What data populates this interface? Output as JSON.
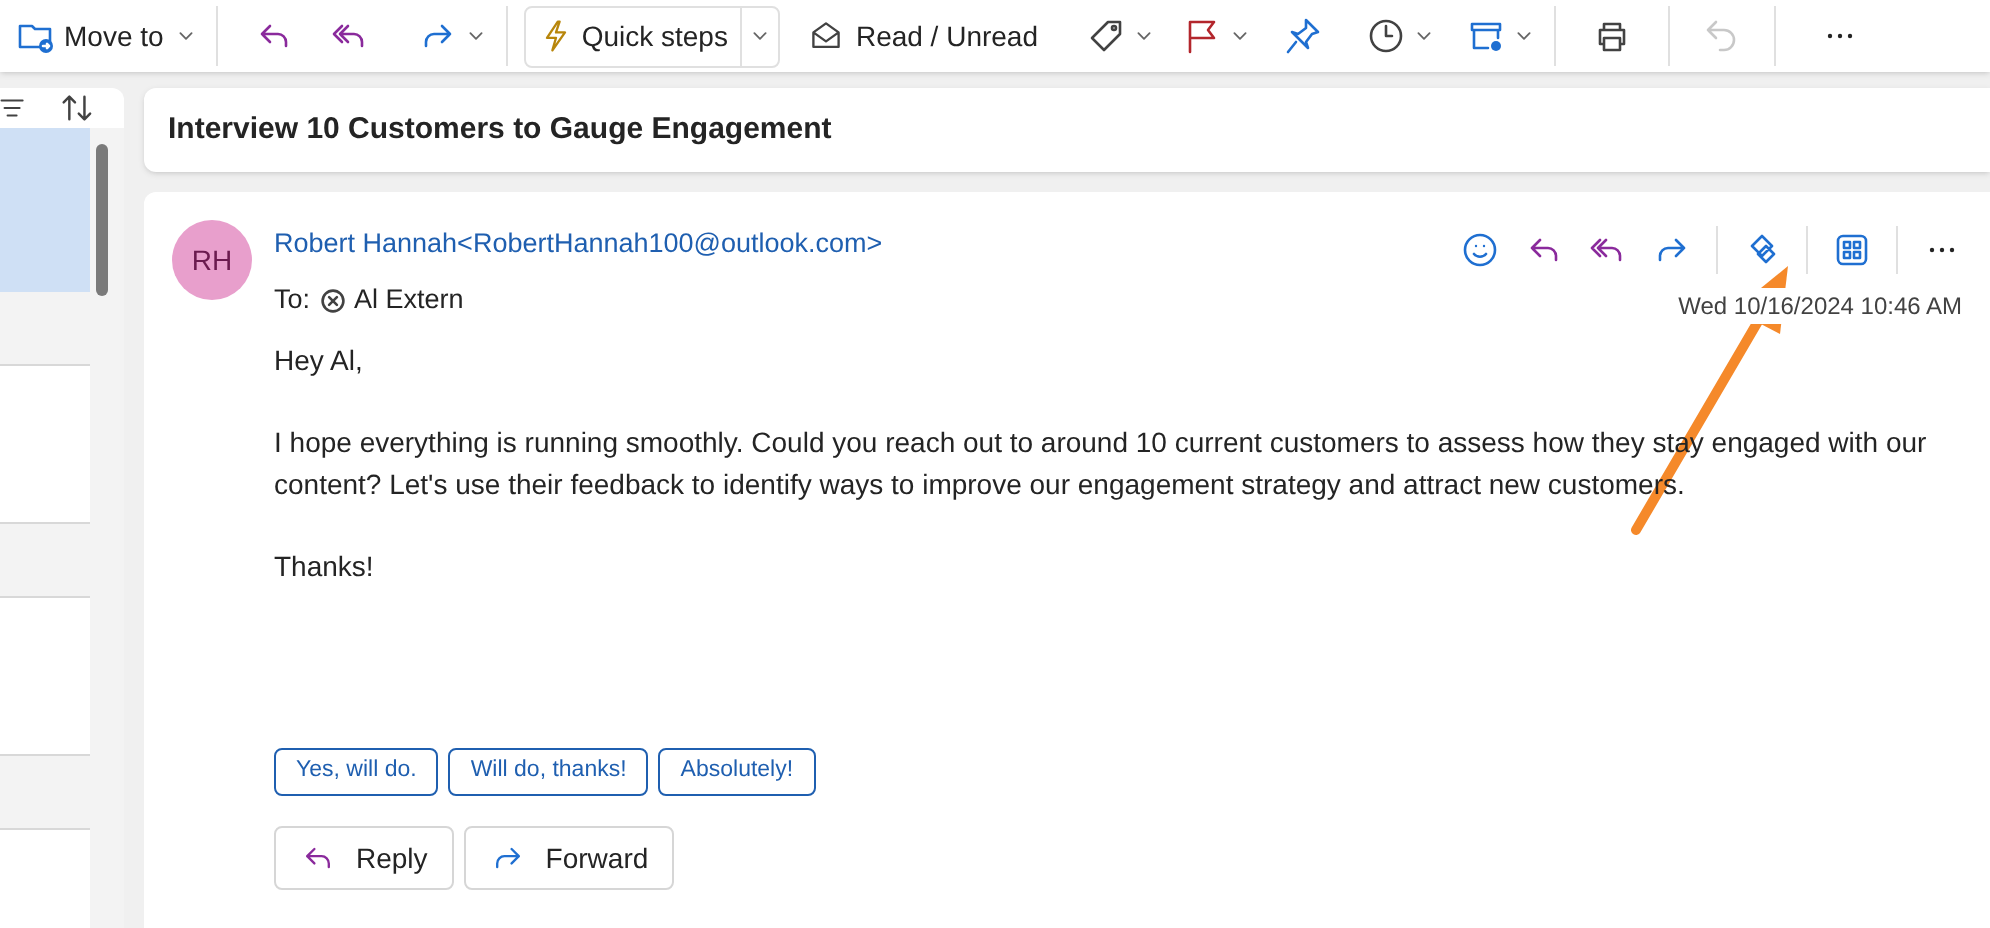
{
  "toolbar": {
    "move_to": "Move to",
    "quick_steps": "Quick steps",
    "read_unread": "Read / Unread",
    "undo": {
      "disabled": true
    }
  },
  "message_list": {
    "items": [
      {
        "selected": true
      },
      {
        "selected": false
      },
      {
        "selected": false
      },
      {
        "selected": false
      }
    ]
  },
  "message": {
    "subject": "Interview 10 Customers to Gauge Engagement",
    "avatar": "RH",
    "sender": "Robert Hannah<RobertHannah100@outlook.com>",
    "to_label": "To:",
    "recipient": "Al Extern",
    "date": "Wed 10/16/2024 10:46 AM",
    "body": [
      "Hey Al,",
      "I hope everything is running smoothly. Could you reach out to around 10 current customers to assess how they stay engaged with our content? Let's use their feedback to identify ways to improve our engagement strategy and attract new customers.",
      "Thanks!"
    ],
    "suggested_replies": [
      "Yes, will do.",
      "Will do, thanks!",
      "Absolutely!"
    ],
    "actions": [
      {
        "kind": "reply",
        "label": "Reply"
      },
      {
        "kind": "forward",
        "label": "Forward"
      }
    ]
  }
}
